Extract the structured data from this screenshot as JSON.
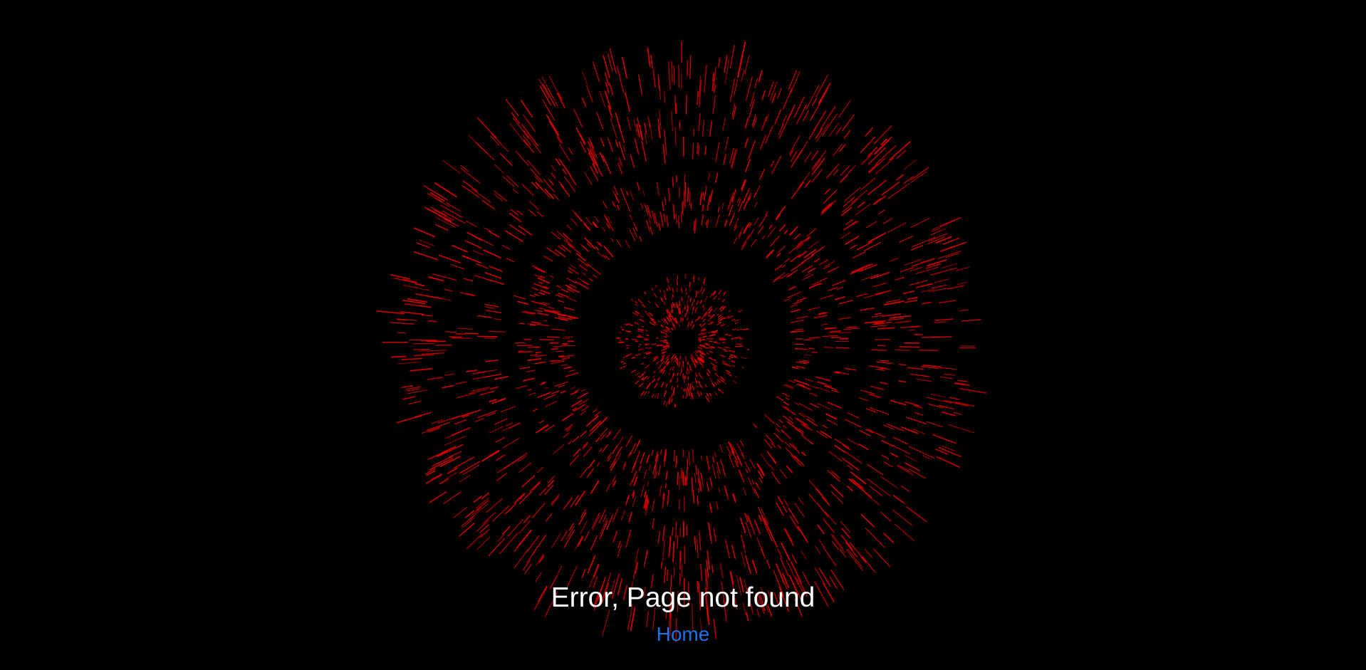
{
  "error_message": "Error, Page not found",
  "home_link_label": "Home",
  "colors": {
    "background": "#000000",
    "particles": "#e00000",
    "message_text": "#ffffff",
    "link": "#1a73e8"
  }
}
